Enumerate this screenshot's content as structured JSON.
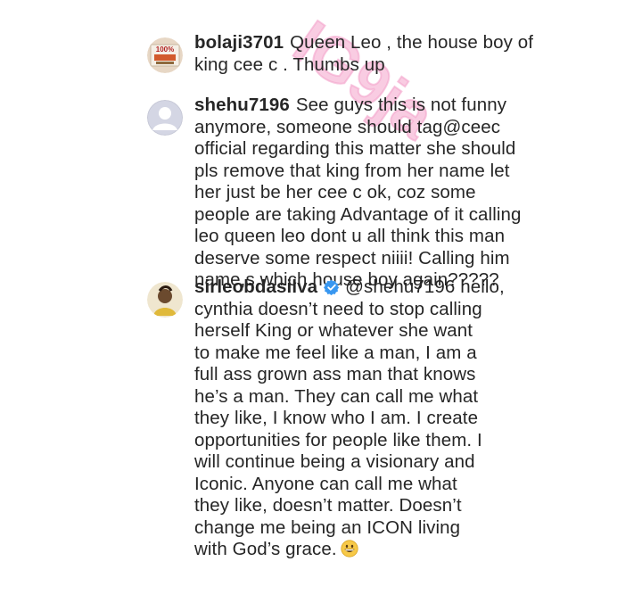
{
  "watermark": {
    "text": "IG9ja",
    "color": "#f39bc7"
  },
  "comments": [
    {
      "username": "bolaji3701",
      "lines": [
        "Queen Leo , the house boy of",
        "king cee c . Thumbs up"
      ],
      "avatar_icon": "profile-photo-100-badge"
    },
    {
      "username": "shehu7196",
      "lines": [
        "See guys this is not funny",
        "anymore, someone should tag@ceec",
        "official regarding this  matter she should",
        "pls remove that king from her name let",
        "her just be her cee c ok, coz some",
        "people are taking Advantage of it calling",
        "leo queen leo dont u all think this man",
        "deserve some respect niiii! Calling him",
        "name,s which house boy again?????"
      ],
      "avatar_icon": "default-user-icon"
    },
    {
      "username": "sirleobdasilva",
      "verified_icon": "verified-badge-icon",
      "mention": "@shehu7196",
      "lines": [
        "hello,",
        "cynthia doesn’t need to stop calling",
        "herself King or whatever she want",
        "to make me feel like a man, I am a",
        "full ass grown ass man that knows",
        "he’s a man. They can call me what",
        "they like, I know who I am. I create",
        "opportunities for people like them. I",
        "will continue being a visionary and",
        "Iconic. Anyone can call me what",
        "they like, doesn’t matter. Doesn’t",
        "change me being an ICON living",
        "with God’s grace."
      ],
      "emoji_icon": "grinning-face-emoji",
      "avatar_icon": "profile-photo"
    }
  ],
  "colors": {
    "text": "#262626",
    "verified": "#3897f0"
  }
}
